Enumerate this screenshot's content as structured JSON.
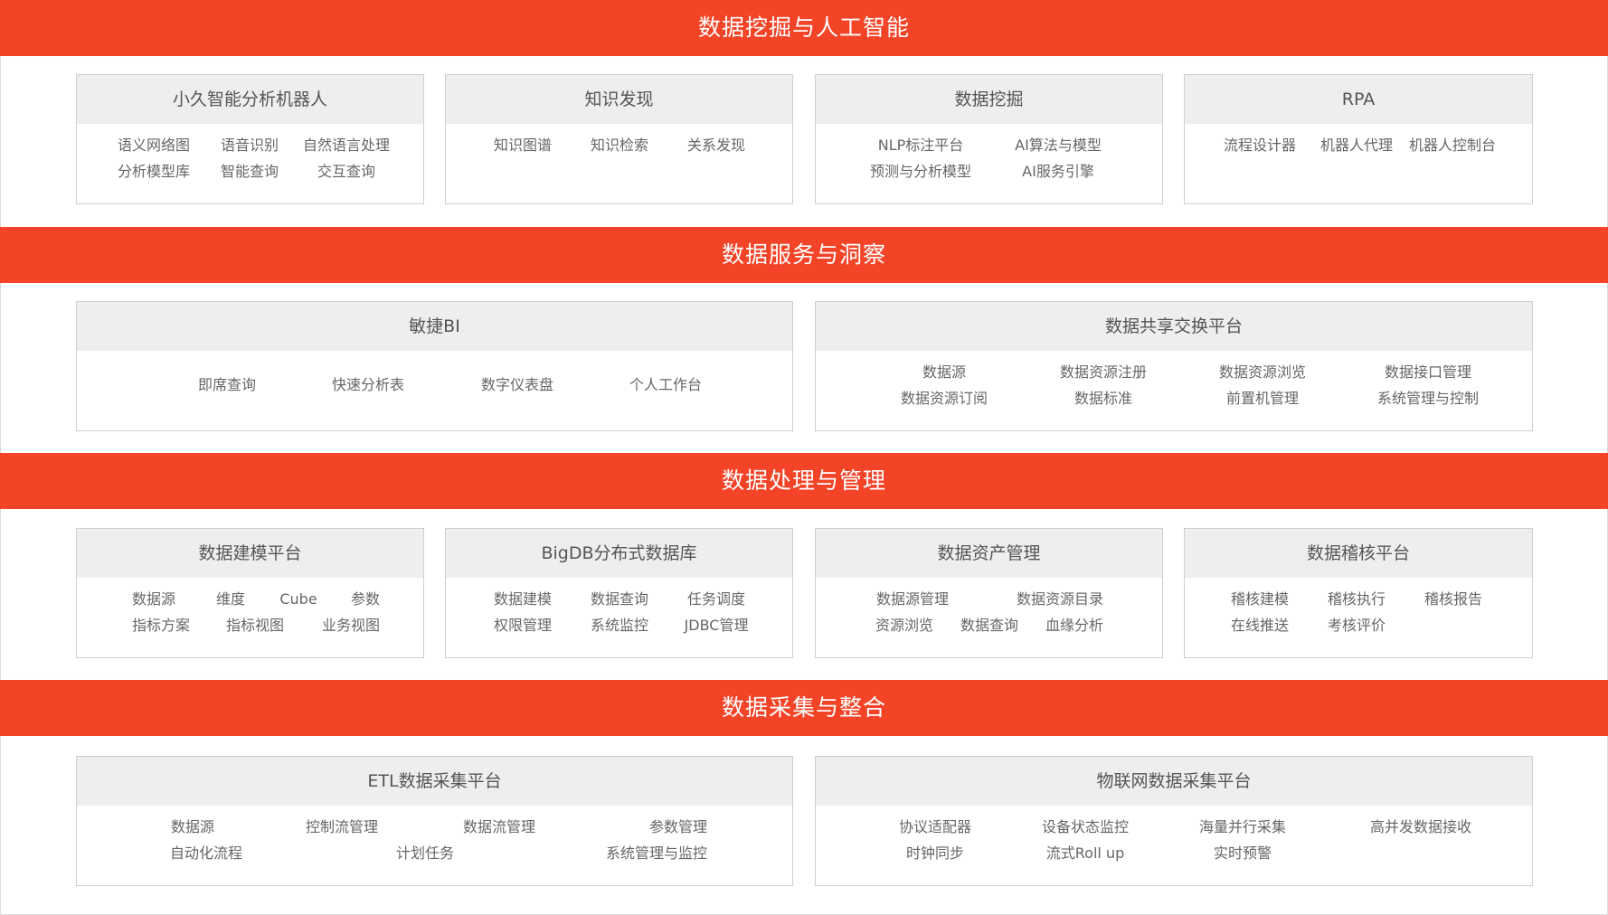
{
  "sections": [
    {
      "title": "数据挖掘与人工智能",
      "boxes": [
        {
          "title": "小久智能分析机器人",
          "row1": [
            "语义网络图",
            "语音识别",
            "自然语言处理"
          ],
          "row2": [
            "分析模型库",
            "智能查询",
            "交互查询"
          ]
        },
        {
          "title": "知识发现",
          "row1": [
            "知识图谱",
            "知识检索",
            "关系发现"
          ],
          "row2": []
        },
        {
          "title": "数据挖掘",
          "row1": [
            "NLP标注平台",
            "AI算法与模型"
          ],
          "row2": [
            "预测与分析模型",
            "AI服务引擎"
          ]
        },
        {
          "title": "RPA",
          "row1": [
            "流程设计器",
            "机器人代理",
            "机器人控制台"
          ],
          "row2": []
        }
      ]
    },
    {
      "title": "数据服务与洞察",
      "boxes": [
        {
          "title": "敏捷BI",
          "row1": [
            "即席查询",
            "快速分析表",
            "数字仪表盘",
            "个人工作台"
          ],
          "row2": []
        },
        {
          "title": "数据共享交换平台",
          "row1": [
            "数据源",
            "数据资源注册",
            "数据资源浏览",
            "数据接口管理"
          ],
          "row2": [
            "数据资源订阅",
            "数据标准",
            "前置机管理",
            "系统管理与控制"
          ]
        }
      ]
    },
    {
      "title": "数据处理与管理",
      "boxes": [
        {
          "title": "数据建模平台",
          "row1": [
            "数据源",
            "维度",
            "Cube",
            "参数"
          ],
          "row2": [
            "指标方案",
            "指标视图",
            "业务视图"
          ]
        },
        {
          "title": "BigDB分布式数据库",
          "row1": [
            "数据建模",
            "数据查询",
            "任务调度"
          ],
          "row2": [
            "权限管理",
            "系统监控",
            "JDBC管理"
          ]
        },
        {
          "title": "数据资产管理",
          "row1": [
            "数据源管理",
            "数据资源目录"
          ],
          "row2": [
            "资源浏览",
            "数据查询",
            "血缘分析"
          ]
        },
        {
          "title": "数据稽核平台",
          "row1": [
            "稽核建模",
            "稽核执行",
            "稽核报告"
          ],
          "row2": [
            "在线推送",
            "考核评价"
          ]
        }
      ]
    },
    {
      "title": "数据采集与整合",
      "boxes": [
        {
          "title": "ETL数据采集平台",
          "row1": [
            "数据源",
            "控制流管理",
            "数据流管理",
            "参数管理"
          ],
          "row2": [
            "自动化流程",
            "计划任务",
            "系统管理与监控"
          ]
        },
        {
          "title": "物联网数据采集平台",
          "row1": [
            "协议适配器",
            "设备状态监控",
            "海量并行采集",
            "高并发数据接收"
          ],
          "row2": [
            "时钟同步",
            "流式Roll up",
            "实时预警"
          ]
        }
      ]
    }
  ],
  "colors": {
    "band": "#f34428",
    "box_head": "#eeeeee",
    "text": "#666666"
  }
}
